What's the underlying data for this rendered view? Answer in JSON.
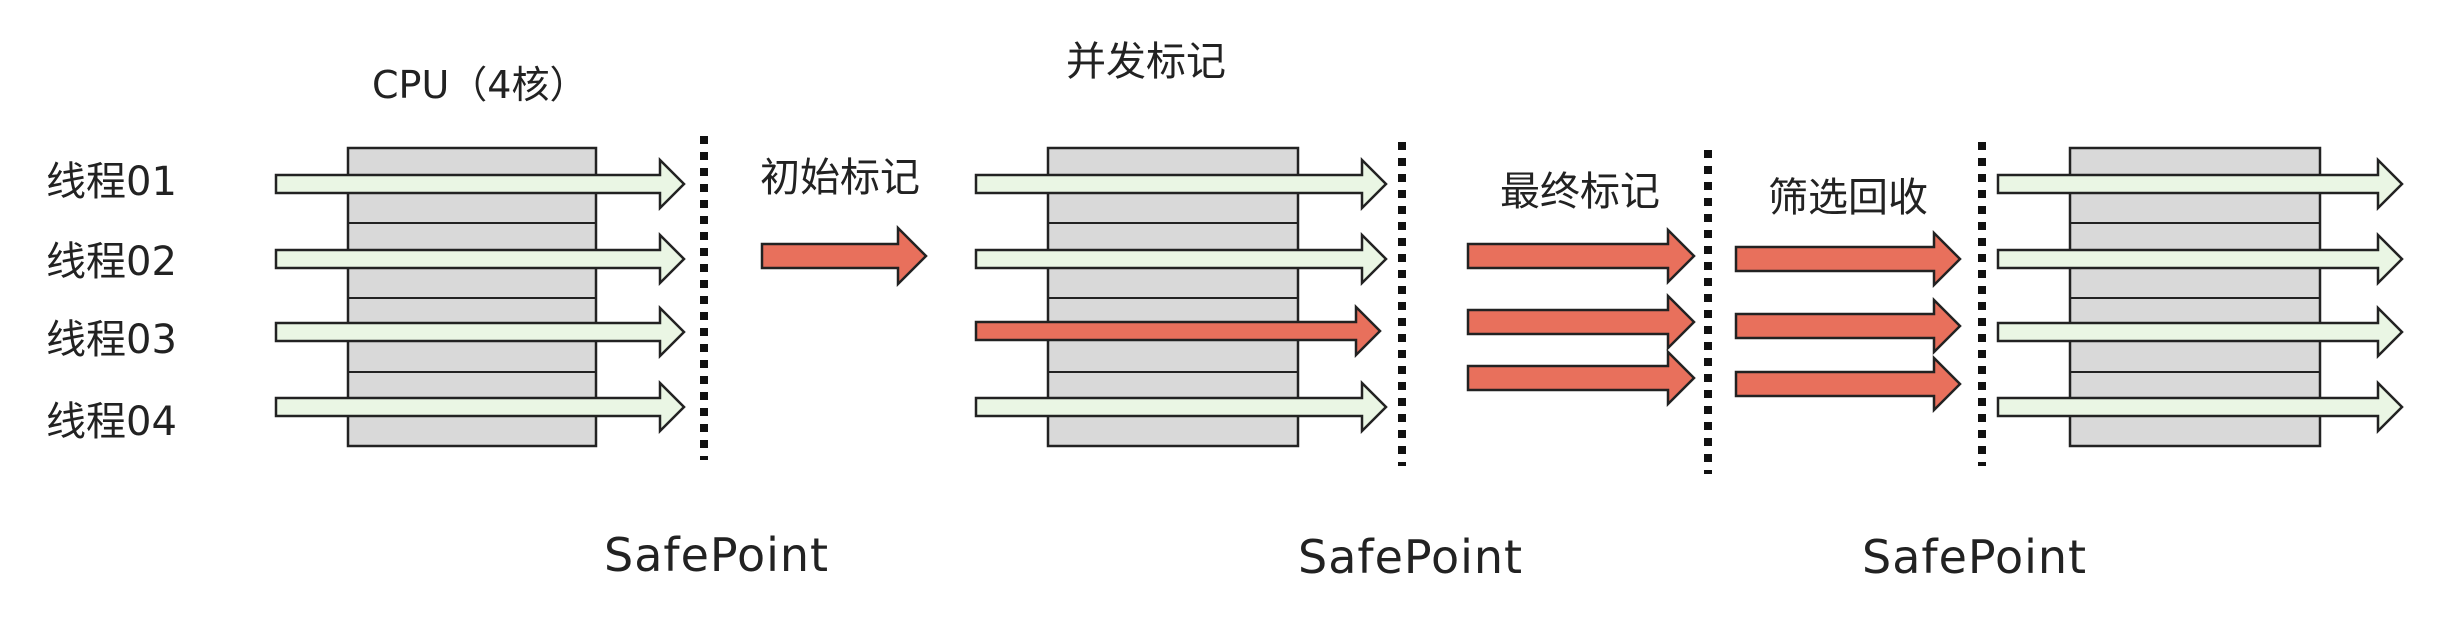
{
  "cpu_label": "CPU（4核）",
  "threads": [
    "线程01",
    "线程02",
    "线程03",
    "线程04"
  ],
  "phases": {
    "initial_mark": "初始标记",
    "concurrent_mark": "并发标记",
    "final_mark": "最终标记",
    "cleanup": "筛选回收"
  },
  "safepoints": [
    "SafePoint",
    "SafePoint",
    "SafePoint"
  ],
  "colors": {
    "thread_arrow_fill": "#eaf6e4",
    "gc_arrow_fill": "#e8705c",
    "cpu_fill": "#d9d9d9",
    "outline": "#222222"
  }
}
